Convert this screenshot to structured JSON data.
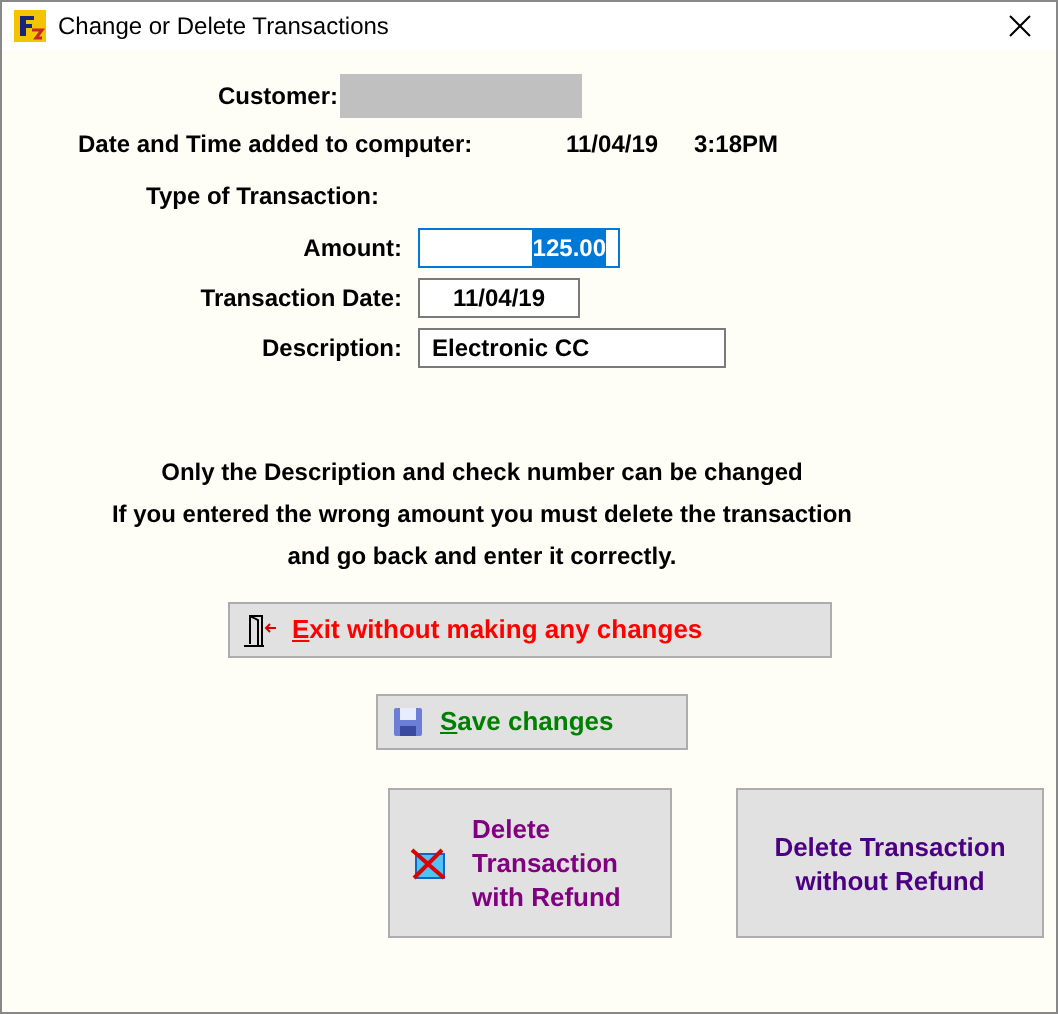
{
  "window": {
    "title": "Change or Delete Transactions"
  },
  "customer": {
    "label": "Customer:",
    "redacted": true
  },
  "added": {
    "label": "Date and Time added to computer:",
    "date": "11/04/19",
    "time": "3:18PM"
  },
  "type_label": "Type of Transaction:",
  "fields": [
    {
      "label": "Amount:",
      "value": "125.00",
      "selected": true
    },
    {
      "label": "Transaction Date:",
      "value": "11/04/19",
      "selected": false
    },
    {
      "label": "Description:",
      "value": "Electronic CC",
      "selected": false
    }
  ],
  "notice": [
    "Only the Description and check number can be changed",
    "If you entered the wrong amount you must delete the transaction",
    "and go back and enter it correctly."
  ],
  "buttons": [
    {
      "kind": "exit",
      "label": "Exit without making any changes",
      "color": "#ff0000",
      "mnemonic": true
    },
    {
      "kind": "save",
      "label": "Save changes",
      "color": "#008000",
      "mnemonic": true
    },
    {
      "kind": "delete-refund",
      "label": "Delete Transaction with Refund",
      "color": "#800080",
      "mnemonic": false
    },
    {
      "kind": "delete-norefund",
      "label": "Delete Transaction without Refund",
      "color": "#4b0082",
      "mnemonic": false
    }
  ]
}
